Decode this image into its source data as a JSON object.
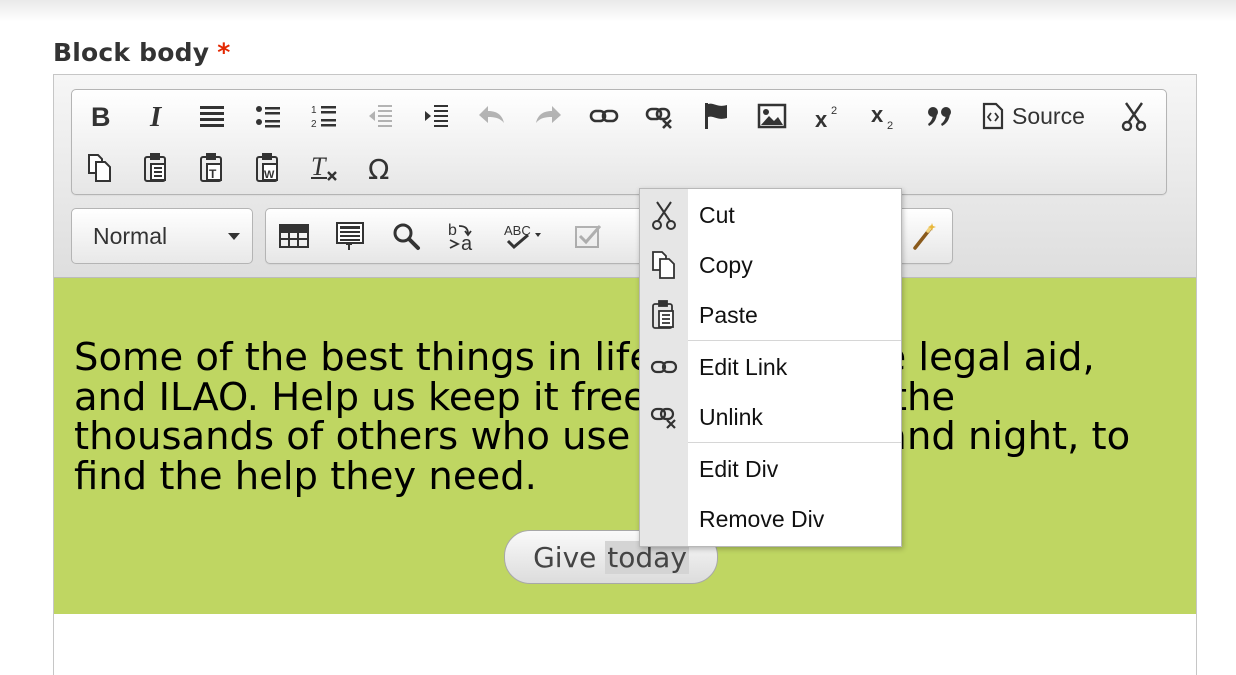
{
  "field": {
    "label": "Block body",
    "required_marker": "*"
  },
  "toolbar": {
    "row1": [
      {
        "name": "bold-icon",
        "title": "Bold"
      },
      {
        "name": "italic-icon",
        "title": "Italic"
      },
      {
        "name": "justify-icon",
        "title": "Justify"
      },
      {
        "name": "bulleted-list-icon",
        "title": "Bulleted list"
      },
      {
        "name": "numbered-list-icon",
        "title": "Numbered list"
      },
      {
        "name": "outdent-icon",
        "title": "Decrease indent",
        "disabled": true
      },
      {
        "name": "indent-icon",
        "title": "Increase indent"
      },
      {
        "name": "undo-icon",
        "title": "Undo",
        "disabled": true
      },
      {
        "name": "redo-icon",
        "title": "Redo",
        "disabled": true
      },
      {
        "name": "link-icon",
        "title": "Link"
      },
      {
        "name": "unlink-icon",
        "title": "Unlink"
      },
      {
        "name": "anchor-flag-icon",
        "title": "Anchor"
      },
      {
        "name": "image-icon",
        "title": "Image"
      },
      {
        "name": "superscript-icon",
        "title": "Superscript"
      },
      {
        "name": "subscript-icon",
        "title": "Subscript"
      },
      {
        "name": "blockquote-icon",
        "title": "Block quote"
      }
    ],
    "source_label": "Source",
    "row2": [
      {
        "name": "copy-icon",
        "title": "Copy"
      },
      {
        "name": "paste-icon",
        "title": "Paste"
      },
      {
        "name": "paste-as-text-icon",
        "title": "Paste as plain text"
      },
      {
        "name": "paste-from-word-icon",
        "title": "Paste from Word"
      },
      {
        "name": "remove-format-icon",
        "title": "Remove format"
      },
      {
        "name": "special-character-icon",
        "title": "Insert special character"
      }
    ],
    "format_value": "Normal",
    "row3": [
      {
        "name": "table-icon",
        "title": "Table"
      },
      {
        "name": "templates-icon",
        "title": "Templates"
      },
      {
        "name": "find-icon",
        "title": "Find"
      },
      {
        "name": "replace-icon",
        "title": "Replace"
      },
      {
        "name": "spellcheck-icon",
        "title": "Spell check"
      },
      {
        "name": "checkbox-icon",
        "title": "Checkbox",
        "disabled": true
      },
      {
        "name": "magic-wand-icon",
        "title": "Magic wand"
      }
    ]
  },
  "content": {
    "paragraph": "Some of the best things in life are free, like legal aid, and ILAO. Help us keep it free for you and the thousands of others who use our site day and night, to find the help they need.",
    "button_prefix": "Give ",
    "button_selected": "today"
  },
  "context_menu": {
    "items": [
      {
        "name": "cut",
        "label": "Cut",
        "icon": "scissors-icon"
      },
      {
        "name": "copy",
        "label": "Copy",
        "icon": "copy-icon"
      },
      {
        "name": "paste",
        "label": "Paste",
        "icon": "paste-icon"
      },
      {
        "name": "edit-link",
        "label": "Edit Link",
        "icon": "link-icon"
      },
      {
        "name": "unlink",
        "label": "Unlink",
        "icon": "unlink-icon"
      },
      {
        "name": "edit-div",
        "label": "Edit Div",
        "icon": ""
      },
      {
        "name": "remove-div",
        "label": "Remove Div",
        "icon": ""
      }
    ]
  },
  "colors": {
    "content_background": "#bfd662",
    "required_marker": "#e32700",
    "menu_gutter": "#e6e6e6"
  }
}
